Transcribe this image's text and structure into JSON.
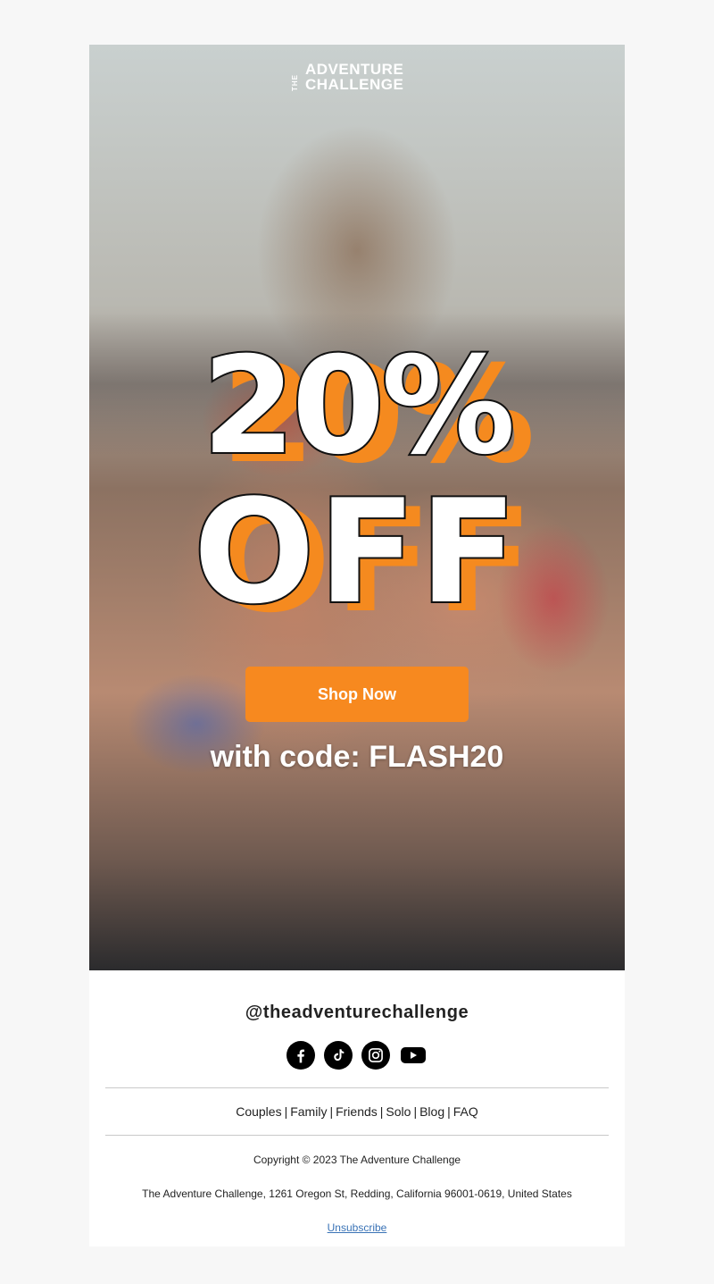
{
  "brand": {
    "logo_the": "THE",
    "logo_line1": "ADVENTURE",
    "logo_line2": "CHALLENGE"
  },
  "hero": {
    "headline_percent": "20%",
    "headline_off": "OFF",
    "cta_label": "Shop Now",
    "code_text": "with code: FLASH20"
  },
  "footer": {
    "handle": "@theadventurechallenge",
    "social_icons": [
      "facebook-icon",
      "tiktok-icon",
      "instagram-icon",
      "youtube-icon"
    ],
    "links": [
      "Couples",
      "Family",
      "Friends",
      "Solo",
      "Blog",
      "FAQ"
    ],
    "copyright": "Copyright © 2023 The Adventure Challenge",
    "address": "The Adventure Challenge, 1261 Oregon St, Redding, California 96001-0619, United States",
    "unsubscribe": "Unsubscribe"
  },
  "colors": {
    "accent": "#f7891f",
    "background": "#f7f7f7",
    "link": "#3a73b6"
  }
}
